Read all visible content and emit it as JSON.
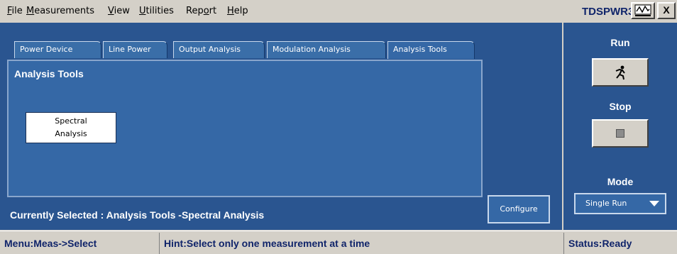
{
  "menu": {
    "items": [
      {
        "label": "File",
        "ul": "F",
        "rest": "ile"
      },
      {
        "label": "Measurements",
        "ul": "M",
        "rest": "easurements"
      },
      {
        "label": "View",
        "ul": "V",
        "rest": "iew"
      },
      {
        "label": "Utilities",
        "ul": "U",
        "rest": "tilities"
      },
      {
        "label": "Report",
        "pre": "Rep",
        "ul": "o",
        "rest": "rt"
      },
      {
        "label": "Help",
        "ul": "H",
        "rest": "elp"
      }
    ]
  },
  "app": {
    "name": "TDSPWR3",
    "close_label": "X"
  },
  "tabs": [
    {
      "label": "Power Device"
    },
    {
      "label": "Line Power"
    },
    {
      "label": "Output Analysis"
    },
    {
      "label": "Modulation Analysis"
    },
    {
      "label": "Analysis Tools",
      "active": true
    }
  ],
  "panel": {
    "title": "Analysis Tools",
    "spectral_line1": "Spectral",
    "spectral_line2": "Analysis"
  },
  "selection": {
    "text": "Currently Selected : Analysis Tools -Spectral Analysis"
  },
  "configure_label": "Configure",
  "side": {
    "run_label": "Run",
    "run_icon": "running-man-icon",
    "stop_label": "Stop",
    "stop_icon": "stop-square-icon",
    "mode_label": "Mode",
    "mode_value": "Single Run"
  },
  "status": {
    "menu": "Menu:Meas->Select",
    "hint": "Hint:Select only one measurement at a time",
    "state": "Status:Ready"
  }
}
